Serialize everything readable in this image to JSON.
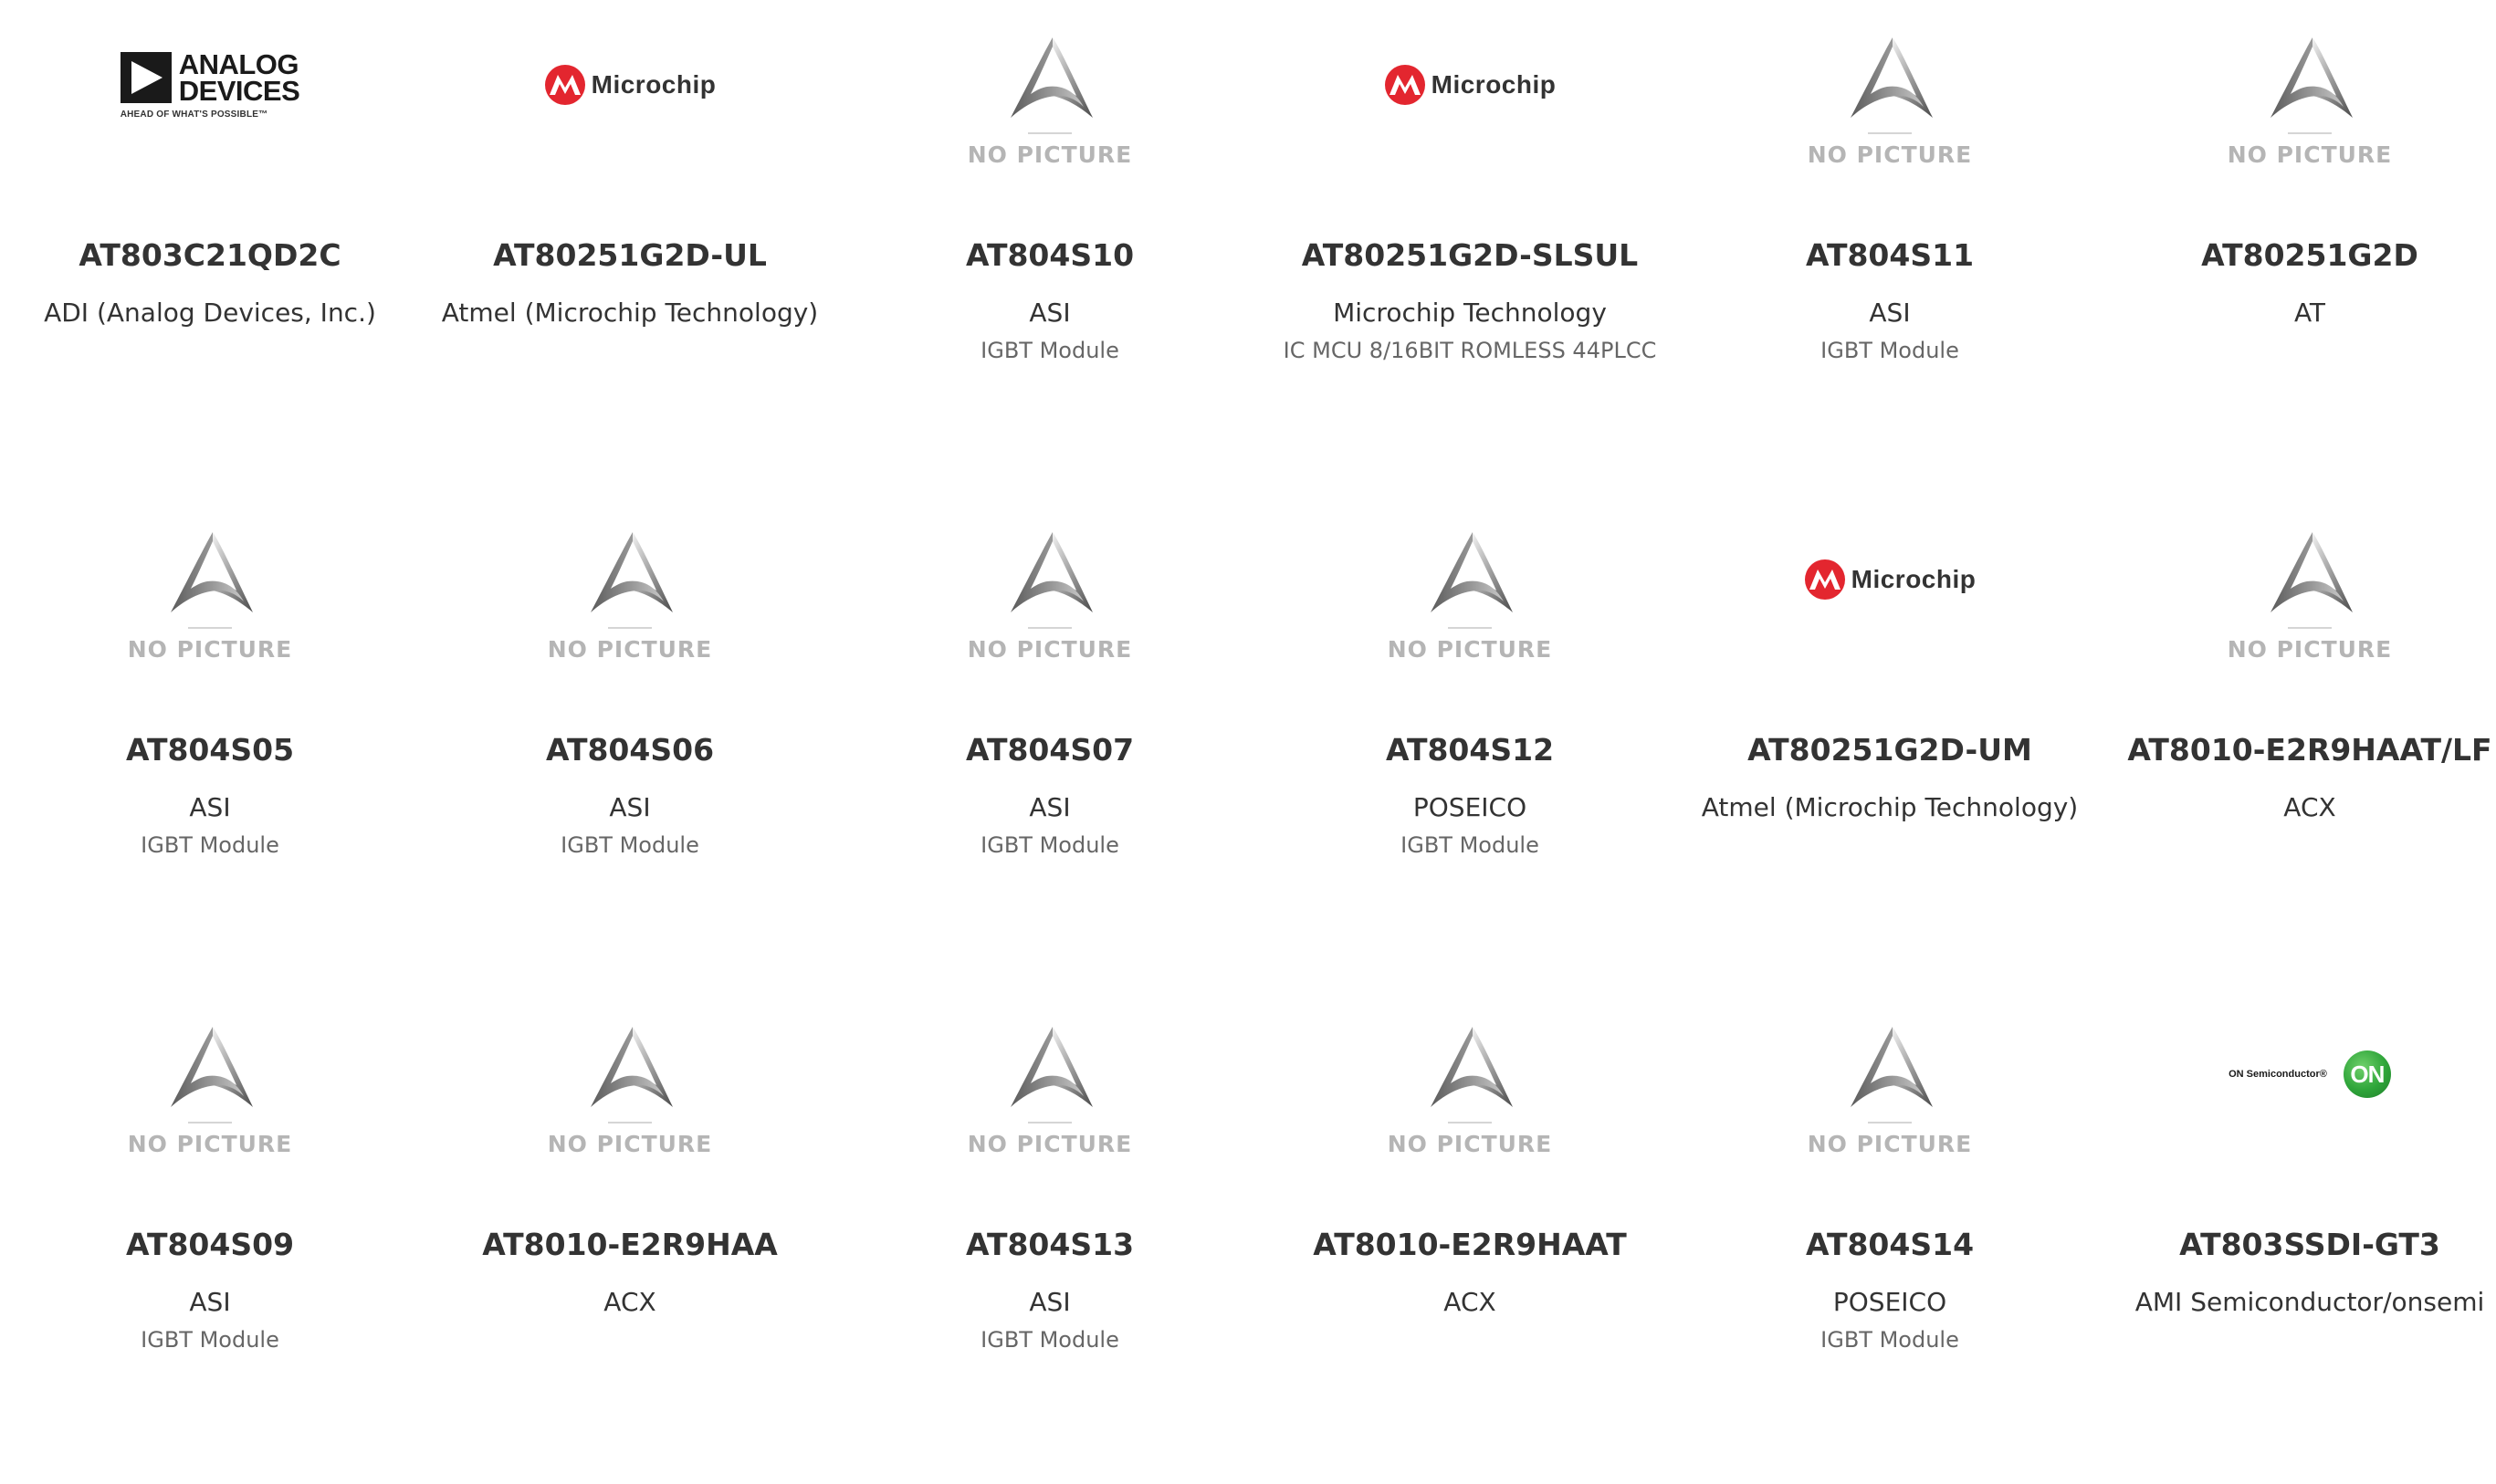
{
  "placeholder": {
    "text": "NO PICTURE"
  },
  "logos": {
    "microchip": "Microchip",
    "adi_line1": "ANALOG",
    "adi_line2": "DEVICES",
    "adi_tagline": "AHEAD OF WHAT'S POSSIBLE™",
    "onsemi_text": "ON Semiconductor®",
    "onsemi_badge": "ON"
  },
  "colors": {
    "text_primary": "#333333",
    "text_secondary": "#666666",
    "placeholder_text": "#b5b5b5",
    "microchip_red": "#e3262f",
    "onsemi_green": "#2fa53a"
  },
  "products": [
    {
      "part": "AT803C21QD2C",
      "manufacturer": "ADI (Analog Devices, Inc.)",
      "description": "",
      "image": "adi-logo"
    },
    {
      "part": "AT80251G2D-UL",
      "manufacturer": "Atmel (Microchip Technology)",
      "description": "",
      "image": "microchip-logo"
    },
    {
      "part": "AT804S10",
      "manufacturer": "ASI",
      "description": "IGBT Module",
      "image": "no-picture"
    },
    {
      "part": "AT80251G2D-SLSUL",
      "manufacturer": "Microchip Technology",
      "description": "IC MCU 8/16BIT ROMLESS 44PLCC",
      "image": "microchip-logo"
    },
    {
      "part": "AT804S11",
      "manufacturer": "ASI",
      "description": "IGBT Module",
      "image": "no-picture"
    },
    {
      "part": "AT80251G2D",
      "manufacturer": "AT",
      "description": "",
      "image": "no-picture"
    },
    {
      "part": "AT804S05",
      "manufacturer": "ASI",
      "description": "IGBT Module",
      "image": "no-picture"
    },
    {
      "part": "AT804S06",
      "manufacturer": "ASI",
      "description": "IGBT Module",
      "image": "no-picture"
    },
    {
      "part": "AT804S07",
      "manufacturer": "ASI",
      "description": "IGBT Module",
      "image": "no-picture"
    },
    {
      "part": "AT804S12",
      "manufacturer": "POSEICO",
      "description": "IGBT Module",
      "image": "no-picture"
    },
    {
      "part": "AT80251G2D-UM",
      "manufacturer": "Atmel (Microchip Technology)",
      "description": "",
      "image": "microchip-logo"
    },
    {
      "part": "AT8010-E2R9HAAT/LF",
      "manufacturer": "ACX",
      "description": "",
      "image": "no-picture"
    },
    {
      "part": "AT804S09",
      "manufacturer": "ASI",
      "description": "IGBT Module",
      "image": "no-picture"
    },
    {
      "part": "AT8010-E2R9HAA",
      "manufacturer": "ACX",
      "description": "",
      "image": "no-picture"
    },
    {
      "part": "AT804S13",
      "manufacturer": "ASI",
      "description": "IGBT Module",
      "image": "no-picture"
    },
    {
      "part": "AT8010-E2R9HAAT",
      "manufacturer": "ACX",
      "description": "",
      "image": "no-picture"
    },
    {
      "part": "AT804S14",
      "manufacturer": "POSEICO",
      "description": "IGBT Module",
      "image": "no-picture"
    },
    {
      "part": "AT803SSDI-GT3",
      "manufacturer": "AMI Semiconductor/onsemi",
      "description": "",
      "image": "onsemi-logo"
    }
  ]
}
